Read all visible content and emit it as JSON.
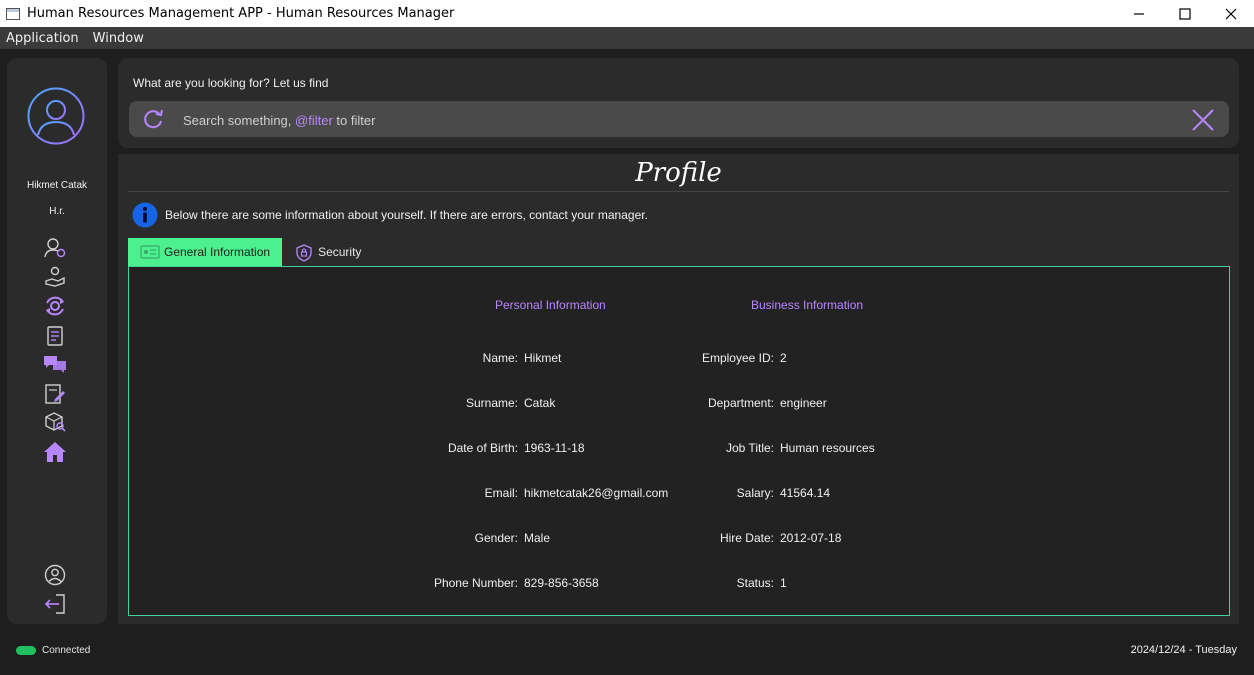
{
  "window": {
    "title": "Human Resources Management APP - Human Resources Manager",
    "controls": [
      "minimize-icon",
      "maximize-icon",
      "close-icon"
    ]
  },
  "menubar": {
    "items": [
      "Application",
      "Window"
    ]
  },
  "sidebar": {
    "user_name": "Hikmet Catak",
    "user_role": "H.r.",
    "nav_icons": [
      "user-settings-icon",
      "hand-care-icon",
      "sync-settings-icon",
      "document-icon",
      "chat-icon",
      "edit-document-icon",
      "package-search-icon",
      "home-icon"
    ],
    "bottom_icons": [
      "profile-icon",
      "logout-icon"
    ]
  },
  "search": {
    "prompt": "What are you looking for? Let us find",
    "placeholder_before": "Search something, ",
    "placeholder_filter": "@filter",
    "placeholder_after": " to filter"
  },
  "profile": {
    "title": "Profile",
    "info": "Below there are some information about yourself. If there are errors, contact your manager.",
    "tabs": [
      {
        "label": "General Information",
        "active": true
      },
      {
        "label": "Security",
        "active": false
      }
    ],
    "personal_heading": "Personal Information",
    "business_heading": "Business Information",
    "personal": [
      {
        "label": "Name:",
        "value": "Hikmet"
      },
      {
        "label": "Surname:",
        "value": "Catak"
      },
      {
        "label": "Date of Birth:",
        "value": "1963-11-18"
      },
      {
        "label": "Email:",
        "value": "hikmetcatak26@gmail.com"
      },
      {
        "label": "Gender:",
        "value": "Male"
      },
      {
        "label": "Phone Number:",
        "value": "829-856-3658"
      }
    ],
    "business": [
      {
        "label": "Employee ID:",
        "value": "2"
      },
      {
        "label": "Department:",
        "value": "engineer"
      },
      {
        "label": "Job Title:",
        "value": "Human resources"
      },
      {
        "label": "Salary:",
        "value": "41564.14"
      },
      {
        "label": "Hire Date:",
        "value": "2012-07-18"
      },
      {
        "label": "Status:",
        "value": "1"
      }
    ]
  },
  "statusbar": {
    "connection": "Connected",
    "date": "2024/12/24 - Tuesday"
  },
  "colors": {
    "accent": "#b887ff",
    "tab_active": "#4cf08f",
    "connected": "#20c060",
    "border": "#3ed49a"
  }
}
